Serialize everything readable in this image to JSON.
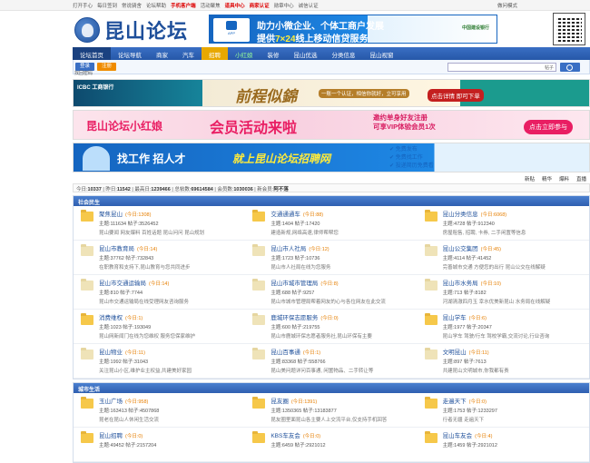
{
  "topbar": {
    "links": [
      "打开手心",
      "每日签到",
      "常说骑舍",
      "论坛帮助",
      "手机客户端",
      "活动聚焦",
      "道具中心",
      "商家认证",
      "勋章中心",
      "诚信认证"
    ],
    "hot_index": [
      4,
      6,
      7
    ],
    "right": "做问模式"
  },
  "logo": {
    "name": "昆山论坛"
  },
  "header_ad": {
    "app_label": "APP",
    "line1": "助力小微企业、个体工商户发展",
    "line2_pre": "提供",
    "line2_hl": "7×24",
    "line2_post": "线上移动信贷服务",
    "bank": "中国建设银行"
  },
  "nav": [
    {
      "label": "论坛首页",
      "style": "active"
    },
    {
      "label": "论坛导航",
      "style": ""
    },
    {
      "label": "商家",
      "style": ""
    },
    {
      "label": "汽车",
      "style": ""
    },
    {
      "label": "招聘",
      "style": "hot"
    },
    {
      "label": "小红娘",
      "style": "green"
    },
    {
      "label": "装修",
      "style": ""
    },
    {
      "label": "昆山优选",
      "style": ""
    },
    {
      "label": "分类信息",
      "style": ""
    },
    {
      "label": "昆山视窗",
      "style": ""
    }
  ],
  "subbar": {
    "login_label": "登录",
    "register_label": "注册",
    "find_password": "找回密码",
    "search_type": "帖子"
  },
  "banners": {
    "b1": {
      "bank": "ICBC 工商银行",
      "title": "前程似錦",
      "slogan": "一账一个认证，相信你就好，立可享用",
      "cta": "点击详情 即可下单"
    },
    "b2": {
      "left": "昆山论坛小红娘",
      "center": "会员活动来啦",
      "right1": "邀约单身好友注册",
      "right2": "可享VIP体验会员1次",
      "cta": "点击立即参与"
    },
    "b3": {
      "left": "找工作 招人才",
      "center": "就上昆山论坛招聘网",
      "list": [
        "免费发布",
        "免费找工作",
        "投递简历免费看"
      ]
    }
  },
  "tabs": [
    "新贴",
    "精华",
    "爆料",
    "直播"
  ],
  "stats": {
    "today_label": "今日:",
    "today": "10337",
    "yesterday_label": "昨日:",
    "yesterday": "11542",
    "max_label": "最高日:",
    "max": "1239466",
    "threads_label": "总帖数:",
    "threads": "69614584",
    "members_label": "会员数:",
    "members": "1030036",
    "newest_label": "新会员:",
    "newest": "阿不落"
  },
  "sections": [
    {
      "title": "社会民生",
      "forums": [
        {
          "name": "聚焦昆山",
          "today": "(今日:1308)",
          "meta": "主题:111634  帖子:3526452",
          "desc": "昆山要闻 网友爆料 百姓话题 昆山问问 昆山规划",
          "active": true
        },
        {
          "name": "交通通通车",
          "today": "(今日:88)",
          "meta": "主题:1404  帖子:17420",
          "desc": "建造新规,网络高速,律师帮帮您",
          "active": true
        },
        {
          "name": "昆山分类信息",
          "today": "(今日:6068)",
          "meta": "主题:4728  帖子:912340",
          "desc": "房屋租售, 招聘, 卡券, 二手闲置等信息",
          "active": true
        },
        {
          "name": "昆山市教育局",
          "today": "(今日:14)",
          "meta": "主题:37762  帖子:732843",
          "desc": "在职教育和支持下,昆山教育与您共同进步",
          "active": false
        },
        {
          "name": "昆山市人社局",
          "today": "(今日:12)",
          "meta": "主题:1723  帖子:10736",
          "desc": "昆山市人社局在线为您服务",
          "active": false
        },
        {
          "name": "昆山公交集团",
          "today": "(今日:45)",
          "meta": "主题:4114  帖子:41452",
          "desc": "完善城市交通 方便您的出行 昆山公交在线解疑",
          "active": false
        },
        {
          "name": "昆山市交通运输局",
          "today": "(今日:14)",
          "meta": "主题:810  帖子:7744",
          "desc": "昆山市交通运输局在线受理网友咨询服务",
          "active": false
        },
        {
          "name": "昆山市城市管理局",
          "today": "(今日:8)",
          "meta": "主题:688  帖子:9257",
          "desc": "昆山市城市管理局帮着网友的心与各位网友在此交流",
          "active": false
        },
        {
          "name": "昆山市水务局",
          "today": "(今日:10)",
          "meta": "主题:713  帖子:8182",
          "desc": "河湖清澈四月玉 幸水优美新昆山 水务局在线解疑",
          "active": false
        },
        {
          "name": "消费维权",
          "today": "(今日:1)",
          "meta": "主题:1023  帖子:193049",
          "desc": "昆山网新闻门在线为您维权 服务您保家维护",
          "active": true
        },
        {
          "name": "鹿城环保志愿服务",
          "today": "(今日:0)",
          "meta": "主题:600  帖子:219755",
          "desc": "昆山市鹿城环保志愿者服务社,昆山环保有主要",
          "active": false
        },
        {
          "name": "昆山学车",
          "today": "(今日:6)",
          "meta": "主题:1977  帖子:20347",
          "desc": "昆山学车 驾驶/行车 驾校学霸,交流讨论,行业咨询",
          "active": true
        },
        {
          "name": "昆山物业",
          "today": "(今日:11)",
          "meta": "主题:1992  帖子:31043",
          "desc": "关注昆山小区,维护业主权益,共建美好家园",
          "active": false
        },
        {
          "name": "昆山百事通",
          "today": "(今日:1)",
          "meta": "主题:83368  帖子:558766",
          "desc": "昆山美问题详问百事通, 闲置物品、二手转让等",
          "active": false
        },
        {
          "name": "文明昆山",
          "today": "(今日:11)",
          "meta": "主题:897  帖子:7613",
          "desc": "共建昆山文明城市,你我都有责",
          "active": false
        }
      ]
    },
    {
      "title": "城市生活",
      "forums": [
        {
          "name": "玉山广场",
          "today": "(今日:958)",
          "meta": "主题:163413  帖子:4507868",
          "desc": "昆老在昆山人休闲生活交流",
          "active": true
        },
        {
          "name": "昆友圈",
          "today": "(今日:1391)",
          "meta": "主题:1350365  帖子:13183877",
          "desc": "昆友圈里面昆山各主要人上交流平台,仅支持手机回答",
          "active": true
        },
        {
          "name": "走遍天下",
          "today": "(今日:0)",
          "meta": "主题:1753  帖子:1233297",
          "desc": "行者无疆 走遍天下",
          "active": true
        },
        {
          "name": "昆山招聘",
          "today": "(今日:0)",
          "meta": "主题:49452  帖子:2157204",
          "desc": "",
          "active": true
        },
        {
          "name": "KBS车友会",
          "today": "(今日:0)",
          "meta": "主题:6459  帖子:2921012",
          "desc": "",
          "active": true
        },
        {
          "name": "昆山车友会",
          "today": "(今日:4)",
          "meta": "主题:1459  帖子:2921012",
          "desc": "",
          "active": true
        }
      ]
    }
  ],
  "colors": {
    "nav_blue": "#2658a8",
    "accent_orange": "#e67e00",
    "link_blue": "#1e4f9a"
  }
}
